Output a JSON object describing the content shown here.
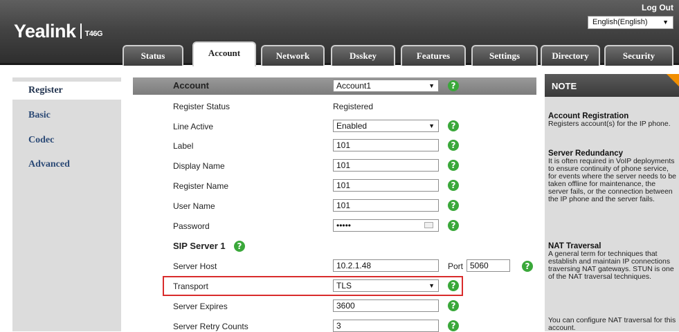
{
  "header": {
    "logo_text": "Yealink",
    "model": "T46G",
    "logout_label": "Log Out",
    "language": "English(English)"
  },
  "tabs": [
    {
      "label": "Status"
    },
    {
      "label": "Account",
      "active": true
    },
    {
      "label": "Network"
    },
    {
      "label": "Dsskey"
    },
    {
      "label": "Features"
    },
    {
      "label": "Settings"
    },
    {
      "label": "Directory"
    },
    {
      "label": "Security"
    }
  ],
  "sidebar": {
    "items": [
      {
        "label": "Register",
        "active": true
      },
      {
        "label": "Basic"
      },
      {
        "label": "Codec"
      },
      {
        "label": "Advanced"
      }
    ]
  },
  "form": {
    "account_label": "Account",
    "account_value": "Account1",
    "register_status_label": "Register Status",
    "register_status_value": "Registered",
    "line_active_label": "Line Active",
    "line_active_value": "Enabled",
    "label_label": "Label",
    "label_value": "101",
    "display_name_label": "Display Name",
    "display_name_value": "101",
    "register_name_label": "Register Name",
    "register_name_value": "101",
    "user_name_label": "User Name",
    "user_name_value": "101",
    "password_label": "Password",
    "password_value": "•••••",
    "sip_server_label": "SIP Server 1",
    "server_host_label": "Server Host",
    "server_host_value": "10.2.1.48",
    "port_label": "Port",
    "port_value": "5060",
    "transport_label": "Transport",
    "transport_value": "TLS",
    "server_expires_label": "Server Expires",
    "server_expires_value": "3600",
    "server_retry_label": "Server Retry Counts",
    "server_retry_value": "3",
    "help_glyph": "?"
  },
  "note": {
    "title": "NOTE",
    "sections": [
      {
        "title": "Account Registration",
        "text": "Registers account(s) for the IP phone."
      },
      {
        "title": "Server Redundancy",
        "text": "It is often required in VoIP deployments to ensure continuity of phone service, for events where the server needs to be taken offline for maintenance, the server fails, or the connection between the IP phone and the server fails."
      },
      {
        "title": "NAT Traversal",
        "text": "A general term for techniques that establish and maintain IP connections traversing NAT gateways. STUN is one of the NAT traversal techniques."
      },
      {
        "title": "",
        "text": "You can configure NAT traversal for this account."
      }
    ]
  },
  "colors": {
    "help_green": "#3aa83a",
    "highlight_red": "#d92b2b",
    "nav_text": "#2c4a76",
    "note_accent": "#f18e00"
  }
}
